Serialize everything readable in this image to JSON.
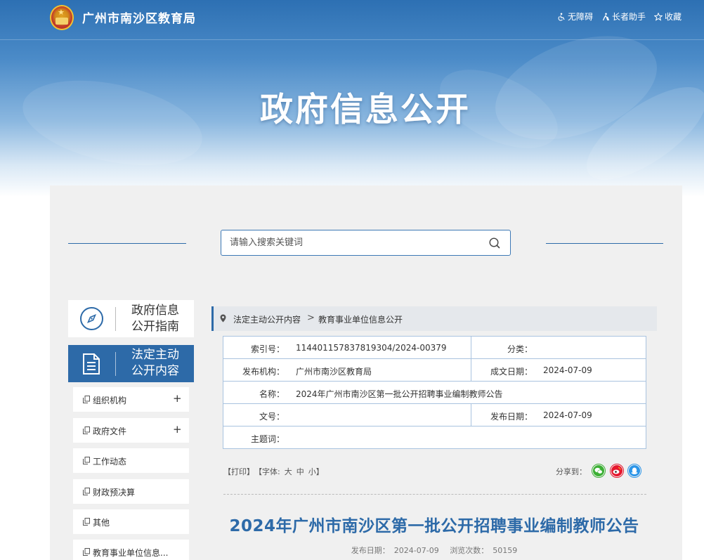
{
  "header": {
    "site_title": "广州市南沙区教育局",
    "links": [
      {
        "label": "无障碍",
        "icon": "wheelchair-icon"
      },
      {
        "label": "长者助手",
        "icon": "elder-icon"
      },
      {
        "label": "收藏",
        "icon": "star-icon"
      }
    ],
    "banner_title": "政府信息公开"
  },
  "search": {
    "placeholder": "请输入搜索关键词"
  },
  "sidebar": {
    "guide": {
      "label_line1": "政府信息",
      "label_line2": "公开指南",
      "icon": "compass-icon"
    },
    "active": {
      "label_line1": "法定主动",
      "label_line2": "公开内容",
      "icon": "document-icon"
    },
    "items": [
      {
        "label": "组织机构",
        "expand": "+"
      },
      {
        "label": "政府文件",
        "expand": "+"
      },
      {
        "label": "工作动态"
      },
      {
        "label": "财政预决算"
      },
      {
        "label": "其他"
      },
      {
        "label": "教育事业单位信息..."
      }
    ]
  },
  "breadcrumb": {
    "level1": "法定主动公开内容",
    "separator": ">",
    "level2": "教育事业单位信息公开"
  },
  "info_table": {
    "index_no_label": "索引号：",
    "index_no": "114401157837819304/2024-00379",
    "category_label": "分类：",
    "category": "",
    "publisher_label": "发布机构：",
    "publisher": "广州市南沙区教育局",
    "created_label": "成文日期：",
    "created": "2024-07-09",
    "name_label": "名称：",
    "name": "2024年广州市南沙区第一批公开招聘事业编制教师公告",
    "doc_no_label": "文号：",
    "doc_no": "",
    "published_label": "发布日期：",
    "published": "2024-07-09",
    "keywords_label": "主题词：",
    "keywords": ""
  },
  "tools": {
    "print": "【打印】",
    "font_prefix": "【字体:",
    "font_large": "大",
    "font_medium": "中",
    "font_small": "小",
    "font_suffix": "】",
    "share_label": "分享到："
  },
  "share": [
    {
      "name": "wechat",
      "icon": "wechat-icon",
      "color": "#3cb034"
    },
    {
      "name": "weibo",
      "icon": "weibo-icon",
      "color": "#e6162d"
    },
    {
      "name": "qq",
      "icon": "qq-icon",
      "color": "#2b95e8"
    }
  ],
  "article": {
    "title": "2024年广州市南沙区第一批公开招聘事业编制教师公告",
    "date_label": "发布日期：",
    "date": "2024-07-09",
    "views_label": "浏览次数：",
    "views": "50159"
  },
  "colors": {
    "primary": "#2d6aa8",
    "panel_bg": "#f0f0f0",
    "table_border": "#a9c3df"
  }
}
